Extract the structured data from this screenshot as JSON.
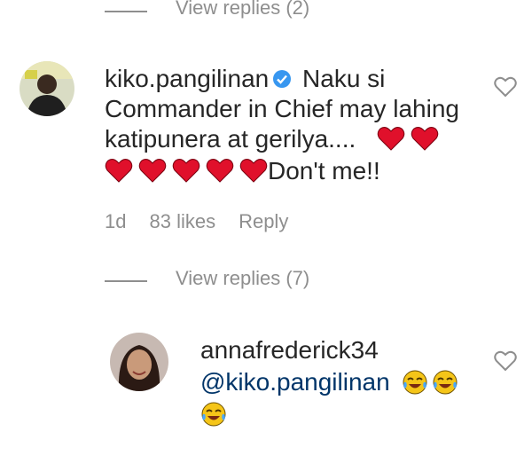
{
  "top_thread": {
    "view_replies": "View replies (2)"
  },
  "comment": {
    "username": "kiko.pangilinan",
    "verified_icon": "verified-badge-icon",
    "line1_text": "Naku si",
    "line2_text": "Commander in Chief may lahing",
    "line3_text": "katipunera at gerilya....",
    "line4_text": "Don't me!!",
    "heart_emoji": "red-heart",
    "time": "1d",
    "likes": "83 likes",
    "reply": "Reply",
    "view_replies": "View replies (7)"
  },
  "reply": {
    "username": "annafrederick34",
    "mention": "@kiko.pangilinan",
    "emoji": "face-with-tears-of-joy"
  },
  "colors": {
    "text": "#262626",
    "muted": "#8e8e8e",
    "verified": "#3897f0",
    "mention": "#003569",
    "heart": "#e0102b"
  }
}
